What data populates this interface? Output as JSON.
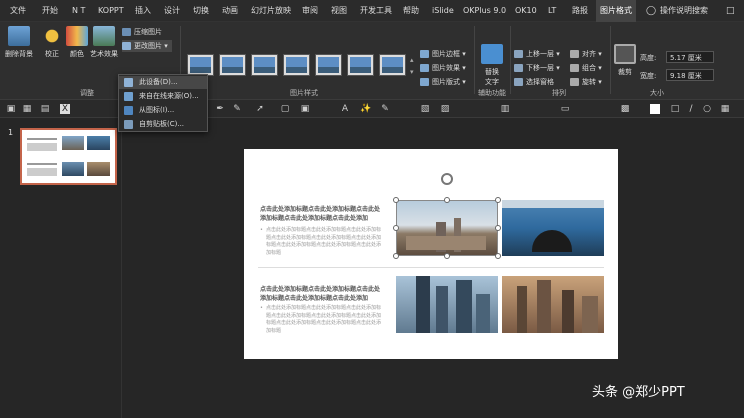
{
  "menubar": {
    "items": [
      "文件",
      "开始",
      "N T",
      "KOPPT",
      "插入",
      "设计",
      "切换",
      "动画",
      "幻灯片放映",
      "审阅",
      "视图",
      "开发工具",
      "帮助",
      "iSlide",
      "OKPlus 9.0",
      "OK10",
      "LT",
      "路报",
      "图片格式"
    ],
    "active_index": 18,
    "search": "操作说明搜索"
  },
  "ribbon": {
    "adjust": {
      "remove_bg": "删除背景",
      "correct": "校正",
      "color": "颜色",
      "art_effect": "艺术效果",
      "compress": "压缩图片",
      "change": "更改图片",
      "group": "调整"
    },
    "styles_group": "图片样式",
    "border": "图片边框",
    "effect": "图片效果",
    "layout": "图片版式",
    "accessibility_label": "替换\n文字",
    "accessibility_group": "辅助功能",
    "arrange": {
      "bring_forward": "上移一层",
      "send_backward": "下移一层",
      "selection_pane": "选择窗格",
      "align": "对齐",
      "group": "组合",
      "rotate": "旋转",
      "label": "排列"
    },
    "crop": "裁剪",
    "size": {
      "height_label": "高度:",
      "height_value": "5.17 厘米",
      "width_label": "宽度:",
      "width_value": "9.18 厘米",
      "label": "大小"
    }
  },
  "dropdown": {
    "items": [
      "此设备(D)...",
      "来自在线来源(O)...",
      "从图标(I)...",
      "自剪贴板(C)..."
    ],
    "hover_index": 0
  },
  "thumbnails": {
    "slide_number": "1"
  },
  "slide": {
    "block1_title": "点击此处添加标题点击此处添加标题点击此处添加标题点击此处添加标题点击此处添加",
    "block1_body": "点击此处添加标题点击此处添加标题点击此处添加标题点击此处添加标题点击此处添加标题点击此处添加标题点击此处添加标题点击此处添加标题点击此处添加标题",
    "block2_title": "点击此处添加标题点击此处添加标题点击此处添加标题点击此处添加标题点击此处添加",
    "block2_body": "点击此处添加标题点击此处添加标题点击此处添加标题点击此处添加标题点击此处添加标题点击此处添加标题点击此处添加标题点击此处添加标题点击此处添加标题"
  },
  "watermark": "头条 @郑少PPT",
  "colors": {
    "accent": "#c4644a",
    "menubar_bg": "#2b2b2b",
    "ribbon_bg": "#2f2f2f"
  }
}
